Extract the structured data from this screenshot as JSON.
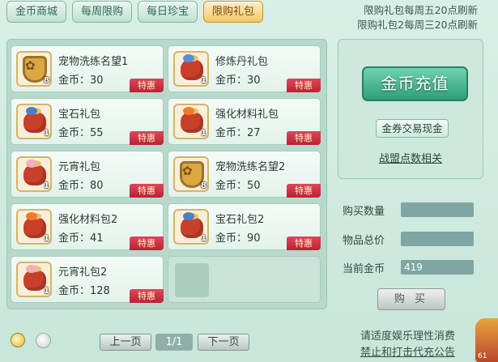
{
  "tabs": [
    {
      "label": "金币商城",
      "active": false
    },
    {
      "label": "每周限购",
      "active": false
    },
    {
      "label": "每日珍宝",
      "active": false
    },
    {
      "label": "限购礼包",
      "active": true
    }
  ],
  "notice": {
    "line1": "限购礼包每周五20点刷新",
    "line2": "限购礼包2每周三20点刷新"
  },
  "items": [
    {
      "name": "宠物洗练名望1",
      "price": "金币：30",
      "count": "8",
      "tag": "特惠",
      "icon": "paw-badge-icon"
    },
    {
      "name": "修炼丹礼包",
      "price": "金币：30",
      "count": "1",
      "tag": "特惠",
      "icon": "gift-bag-icon"
    },
    {
      "name": "宝石礼包",
      "price": "金币：55",
      "count": "1",
      "tag": "特惠",
      "icon": "gift-bag-icon"
    },
    {
      "name": "强化材料礼包",
      "price": "金币：27",
      "count": "1",
      "tag": "特惠",
      "icon": "gift-bag-icon"
    },
    {
      "name": "元宵礼包",
      "price": "金币：80",
      "count": "1",
      "tag": "特惠",
      "icon": "gift-bag-icon"
    },
    {
      "name": "宠物洗练名望2",
      "price": "金币：50",
      "count": "8",
      "tag": "特惠",
      "icon": "paw-badge-icon"
    },
    {
      "name": "强化材料包2",
      "price": "金币：41",
      "count": "1",
      "tag": "特惠",
      "icon": "gift-bag-icon"
    },
    {
      "name": "宝石礼包2",
      "price": "金币：90",
      "count": "1",
      "tag": "特惠",
      "icon": "gift-bag-icon"
    },
    {
      "name": "元宵礼包2",
      "price": "金币：128",
      "count": "1",
      "tag": "特惠",
      "icon": "gift-bag-icon"
    }
  ],
  "right": {
    "recharge": "金币充值",
    "exchange": "金券交易现金",
    "alliance": "战盟点数相关",
    "qty_label": "购买数量",
    "qty_value": "",
    "total_label": "物品总价",
    "total_value": "",
    "gold_label": "当前金币",
    "gold_value": "419",
    "buy": "购 买"
  },
  "footer": {
    "prev": "上一页",
    "page": "1/1",
    "next": "下一页",
    "warn1": "请适度娱乐理性消费",
    "warn2": "禁止和打击代充公告",
    "corner": "61"
  },
  "colors": {
    "accent_green": "#2f9f7c",
    "tag_red": "#c7283a",
    "active_tab": "#f4c765"
  }
}
